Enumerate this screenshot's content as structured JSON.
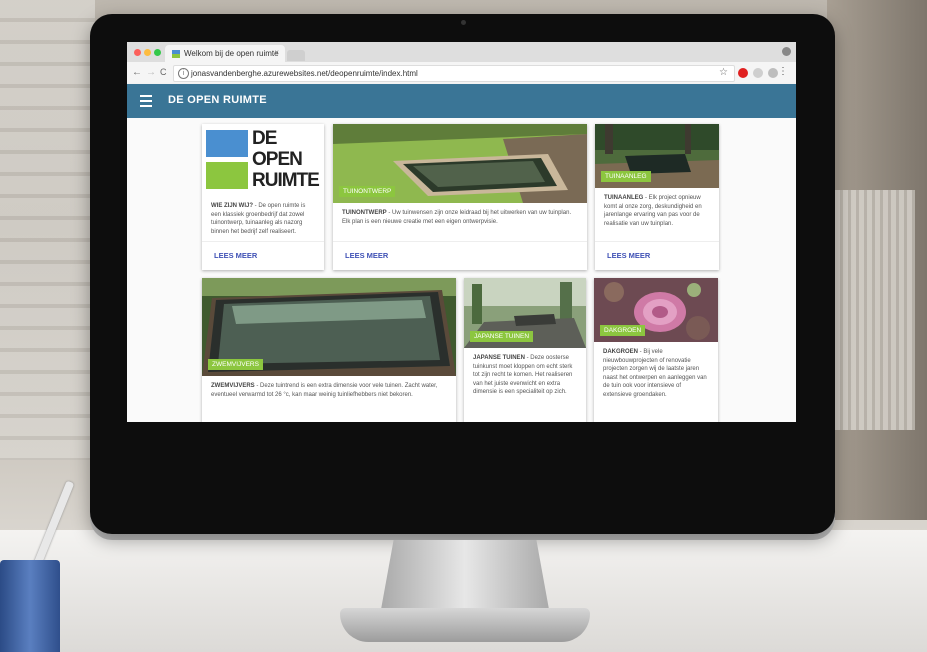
{
  "browser": {
    "tab_title": "Welkom bij de open ruimte",
    "tab_close": "×",
    "url": "jonasvandenberghe.azurewebsites.net/deopenruimte/index.html",
    "back": "←",
    "forward": "→",
    "reload": "C",
    "info": "i",
    "star": "☆",
    "menu": "⋮",
    "traffic_colors": [
      "#fc605b",
      "#fdbc40",
      "#34c84a"
    ]
  },
  "appbar": {
    "title": "DE OPEN RUIMTE",
    "color": "#3a7596"
  },
  "logo": {
    "lines": [
      "DE",
      "OPEN",
      "RUIMTE"
    ],
    "colors": [
      "#4a8fd0",
      "#8cc63f"
    ]
  },
  "cards": [
    {
      "lead": "WIE ZIJN WIJ?",
      "text": " - De open ruimte is een klassiek groenbedrijf dat zowel tuinontwerp, tuinaanleg als nazorg binnen het bedrijf zelf realiseert.",
      "action": "LEES MEER"
    },
    {
      "chip": "TUINONTWERP",
      "lead": "TUINONTWERP",
      "text": " - Uw tuinwensen zijn onze leidraad bij het uitwerken van uw tuinplan. Elk plan is een nieuwe creatie met een eigen ontwerpvisie.",
      "action": "LEES MEER"
    },
    {
      "chip": "TUINAANLEG",
      "lead": "TUINAANLEG",
      "text": " - Elk project opnieuw komt al onze zorg, deskundigheid en jarenlange ervaring van pas voor de realisatie van uw tuinplan.",
      "action": "LEES MEER"
    },
    {
      "chip": "ZWEMVIJVERS",
      "lead": "ZWEMVIJVERS",
      "text": " - Deze tuintrend is een extra dimensie voor vele tuinen. Zacht water, eventueel verwarmd tot 26 °c, kan maar weinig tuinliefhebbers niet bekoren."
    },
    {
      "chip": "JAPANSE TUINEN",
      "lead": "JAPANSE TUINEN",
      "text": " - Deze oosterse tuinkunst moet kloppen om echt sterk tot zijn recht te komen. Het realiseren van het juiste evenwicht en extra dimensie is een specialiteit op zich."
    },
    {
      "chip": "DAKGROEN",
      "lead": "DAKGROEN",
      "text": " - Bij vele nieuwbouwprojecten of renovatie projecten zorgen wij de laatste jaren naast het ontwerpen en aanleggen van de tuin ook voor intensieve of extensieve groendaken."
    }
  ]
}
